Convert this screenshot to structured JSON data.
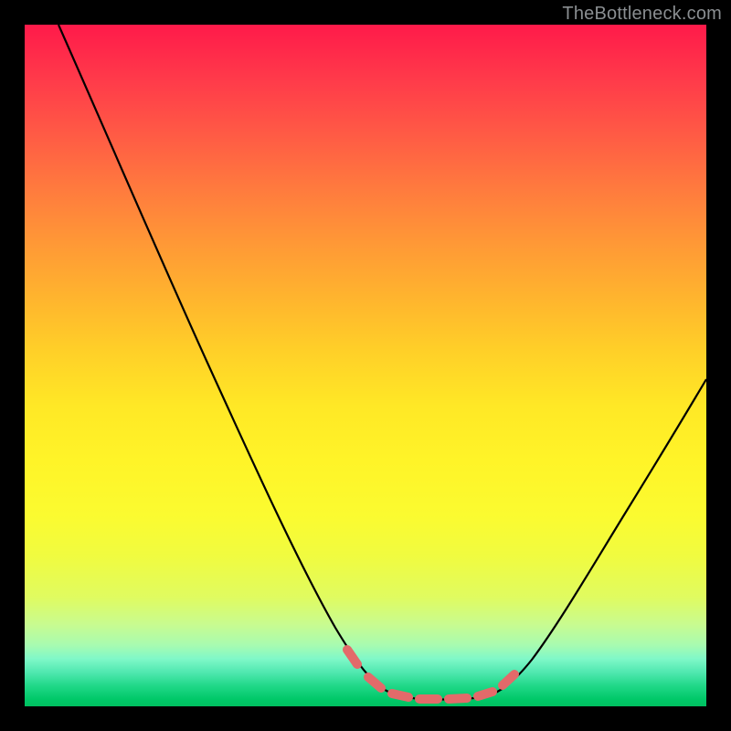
{
  "watermark": "TheBottleneck.com",
  "chart_data": {
    "type": "line",
    "title": "",
    "xlabel": "",
    "ylabel": "",
    "xlim": [
      0,
      100
    ],
    "ylim": [
      0,
      100
    ],
    "grid": false,
    "legend": false,
    "series": [
      {
        "name": "curve",
        "color": "#000000",
        "x": [
          5,
          10,
          15,
          20,
          25,
          30,
          35,
          40,
          45,
          48,
          50,
          52,
          55,
          58,
          62,
          65,
          68,
          72,
          76,
          80,
          84,
          88,
          92,
          96,
          100
        ],
        "y": [
          100,
          90,
          80,
          70,
          59,
          48,
          37,
          26,
          14,
          7,
          4,
          2,
          1,
          1,
          1,
          1,
          2,
          4,
          9,
          15,
          22,
          29,
          37,
          45,
          52
        ]
      },
      {
        "name": "highlight-dashes",
        "color": "#e36a6a",
        "x": [
          48,
          50,
          52,
          55,
          58,
          62,
          65,
          68
        ],
        "y": [
          7,
          4,
          2,
          1,
          1,
          1,
          1,
          2
        ]
      }
    ],
    "background_gradient": {
      "stops": [
        {
          "pos": 0.0,
          "color": "#ff1a4a"
        },
        {
          "pos": 0.5,
          "color": "#ffd028"
        },
        {
          "pos": 0.8,
          "color": "#f0fb40"
        },
        {
          "pos": 1.0,
          "color": "#00c060"
        }
      ]
    }
  }
}
